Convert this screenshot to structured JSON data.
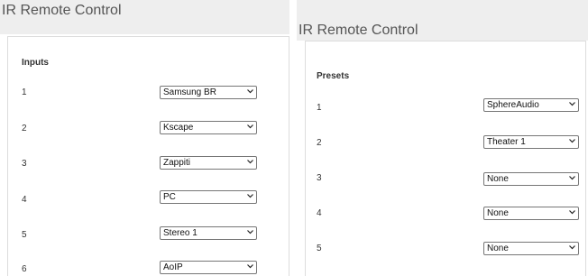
{
  "left_panel": {
    "title": "IR Remote Control",
    "section": "Inputs",
    "rows": [
      {
        "num": "1",
        "value": "Samsung BR"
      },
      {
        "num": "2",
        "value": "Kscape"
      },
      {
        "num": "3",
        "value": "Zappiti"
      },
      {
        "num": "4",
        "value": "PC"
      },
      {
        "num": "5",
        "value": "Stereo 1"
      },
      {
        "num": "6",
        "value": "AoIP"
      }
    ]
  },
  "right_panel": {
    "title": "IR Remote Control",
    "section": "Presets",
    "rows": [
      {
        "num": "1",
        "value": "SphereAudio"
      },
      {
        "num": "2",
        "value": "Theater 1"
      },
      {
        "num": "3",
        "value": "None"
      },
      {
        "num": "4",
        "value": "None"
      },
      {
        "num": "5",
        "value": "None"
      }
    ]
  },
  "icons": {
    "dropdown": "chevron-down-icon"
  }
}
